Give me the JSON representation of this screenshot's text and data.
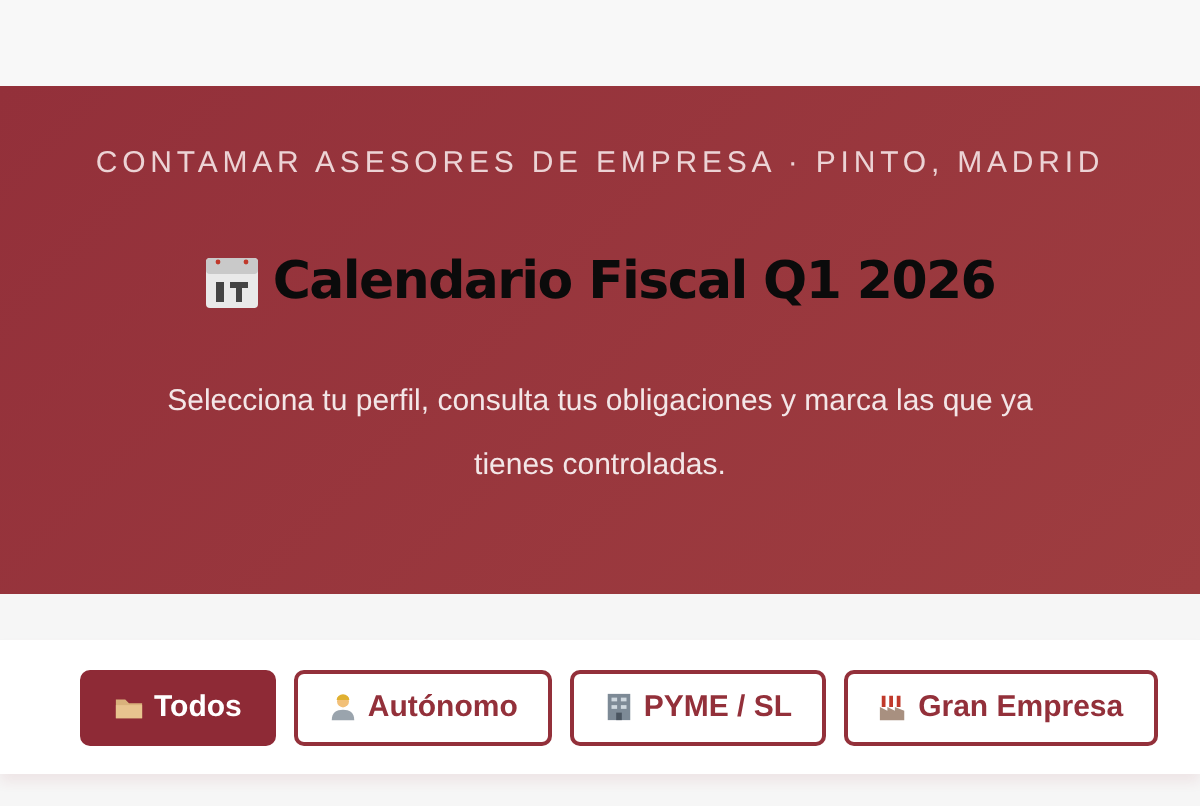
{
  "header": {
    "eyebrow": "CONTAMAR ASESORES DE EMPRESA · PINTO, MADRID",
    "title": "Calendario Fiscal Q1 2026",
    "subtitle": "Selecciona tu perfil, consulta tus obligaciones y marca las que ya tienes controladas."
  },
  "tabs": [
    {
      "label": "Todos",
      "kind": "folder",
      "selected": true
    },
    {
      "label": "Autónomo",
      "kind": "person",
      "selected": false
    },
    {
      "label": "PYME / SL",
      "kind": "building",
      "selected": false
    },
    {
      "label": "Gran Empresa",
      "kind": "factory",
      "selected": false
    }
  ]
}
